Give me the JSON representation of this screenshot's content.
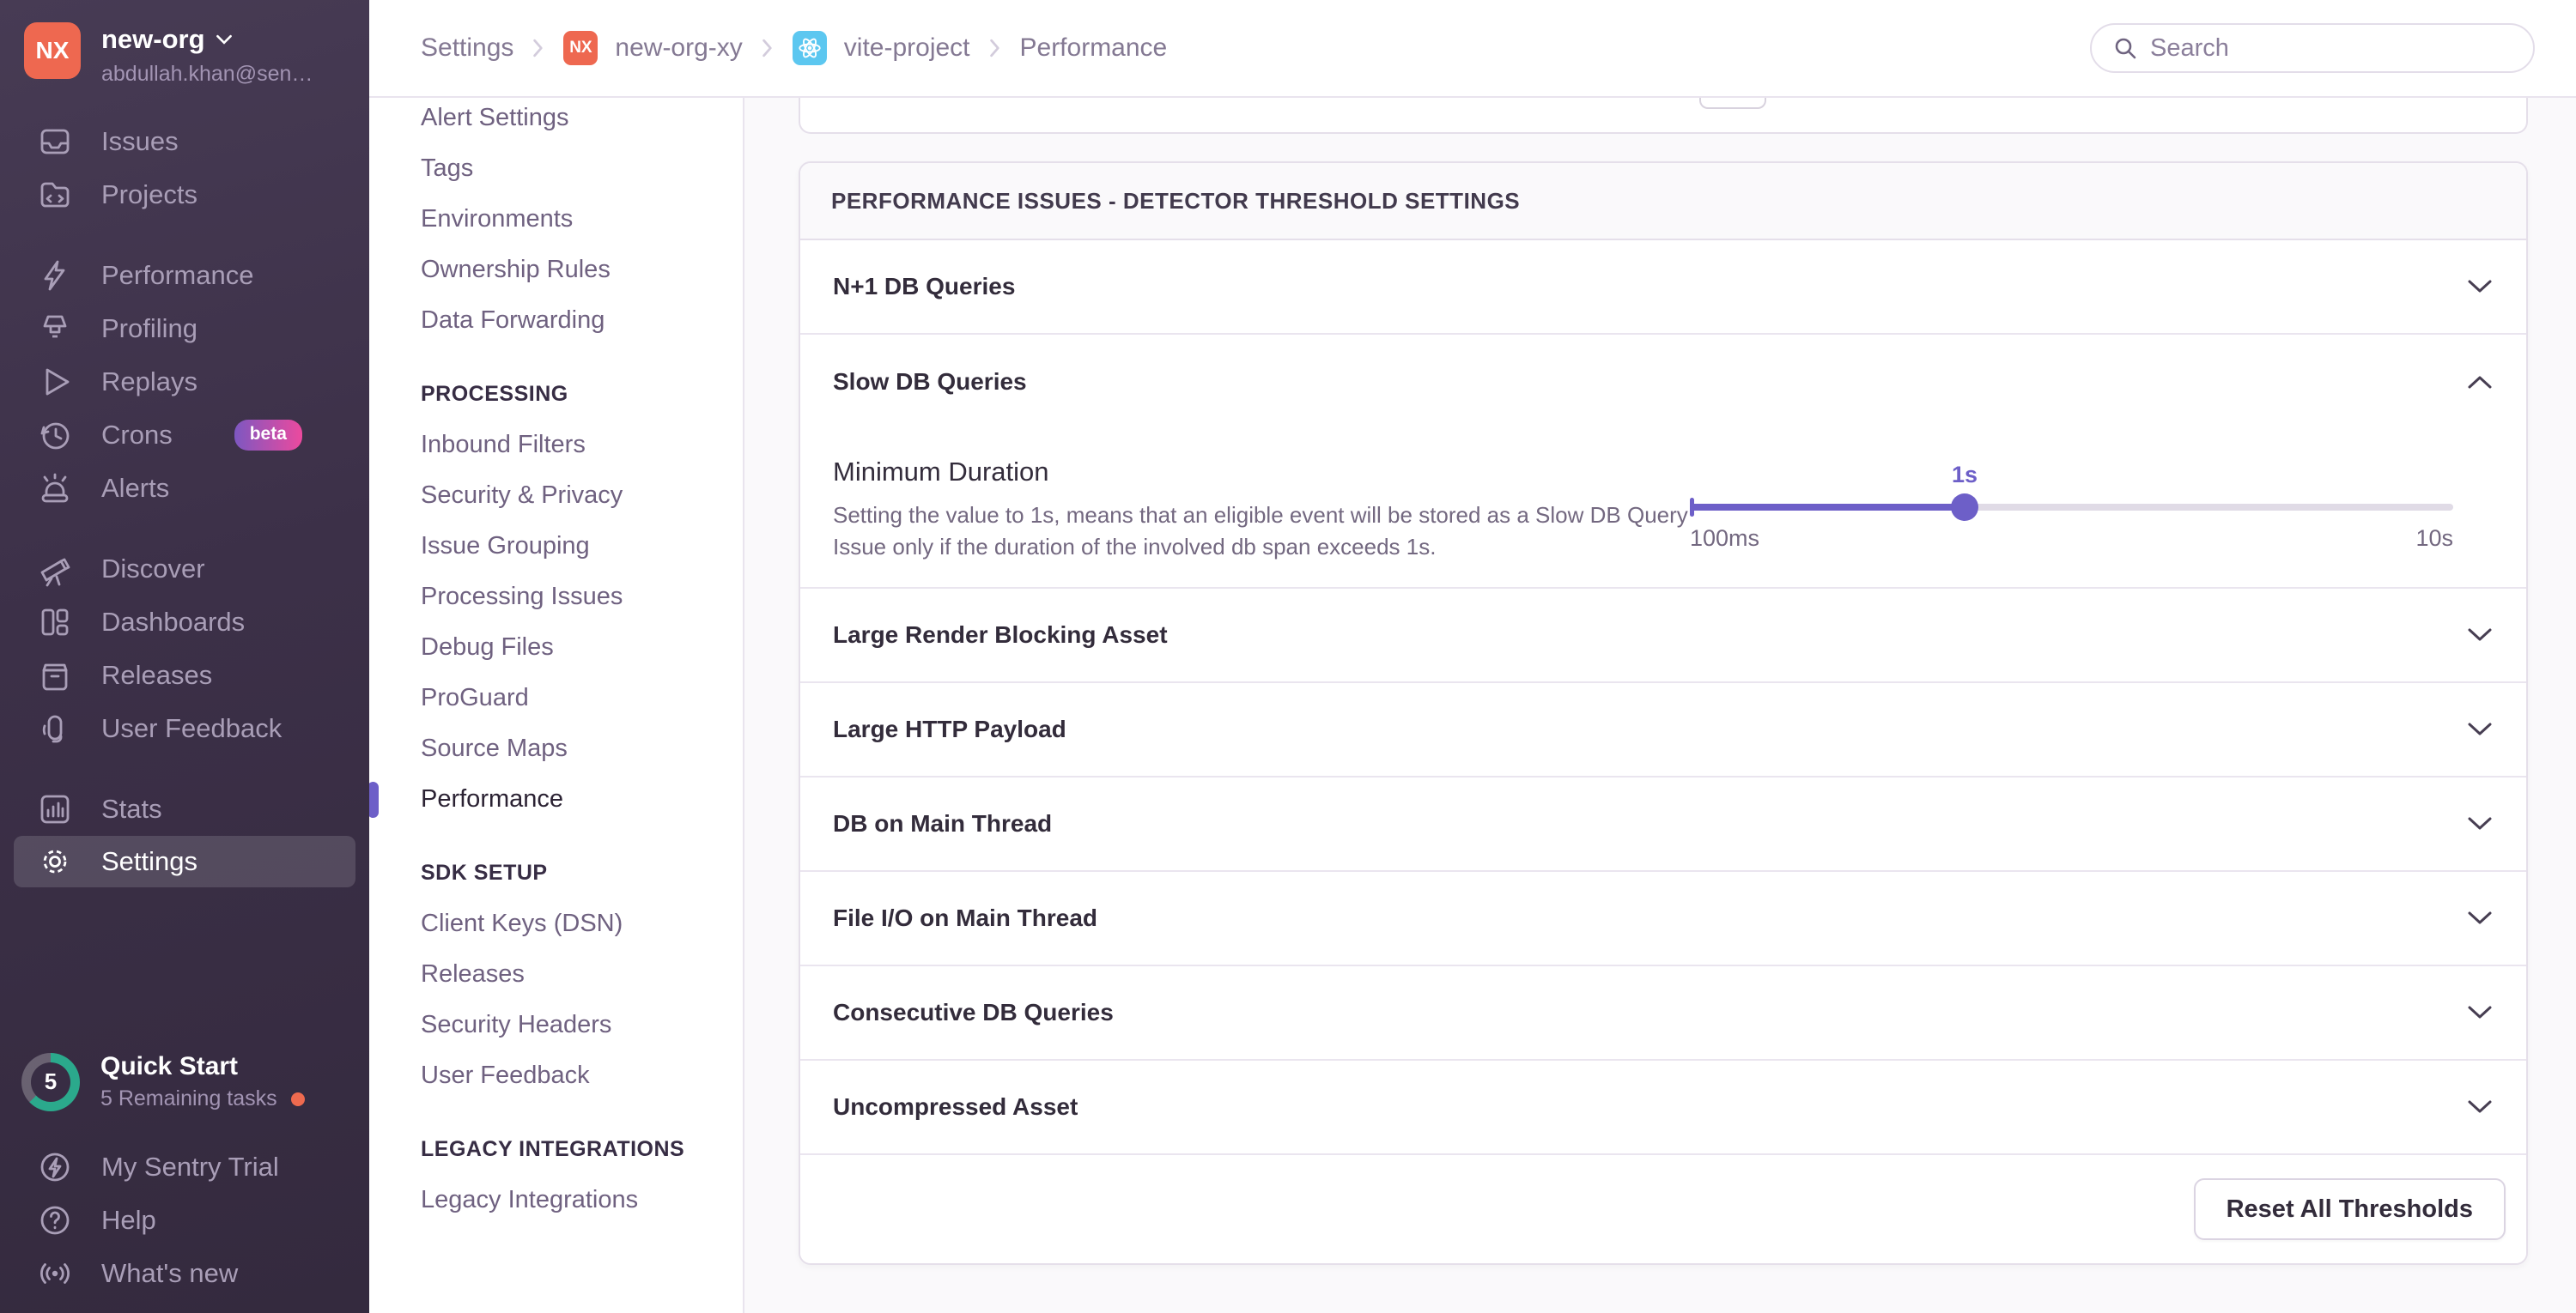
{
  "org": {
    "name": "new-org",
    "initials": "NX",
    "email": "abdullah.khan@sen…"
  },
  "topbar": {
    "breadcrumb": {
      "level1": "Settings",
      "org": "new-org-xy",
      "project": "vite-project",
      "page": "Performance"
    },
    "search_placeholder": "Search"
  },
  "sidebar": {
    "groups": [
      {
        "items": [
          {
            "label": "Issues"
          },
          {
            "label": "Projects"
          }
        ]
      },
      {
        "items": [
          {
            "label": "Performance"
          },
          {
            "label": "Profiling"
          },
          {
            "label": "Replays"
          },
          {
            "label": "Crons",
            "badge": "beta"
          },
          {
            "label": "Alerts"
          }
        ]
      },
      {
        "items": [
          {
            "label": "Discover"
          },
          {
            "label": "Dashboards"
          },
          {
            "label": "Releases"
          },
          {
            "label": "User Feedback"
          }
        ]
      },
      {
        "items": [
          {
            "label": "Stats"
          },
          {
            "label": "Settings"
          }
        ]
      }
    ],
    "quickstart": {
      "count": "5",
      "title": "Quick Start",
      "subtitle": "5 Remaining tasks"
    },
    "footer_items": [
      {
        "label": "My Sentry Trial"
      },
      {
        "label": "Help"
      },
      {
        "label": "What's new"
      }
    ]
  },
  "settings_menu": {
    "top_items": [
      "Alert Settings",
      "Tags",
      "Environments",
      "Ownership Rules",
      "Data Forwarding"
    ],
    "sections": [
      {
        "header": "PROCESSING",
        "items": [
          "Inbound Filters",
          "Security & Privacy",
          "Issue Grouping",
          "Processing Issues",
          "Debug Files",
          "ProGuard",
          "Source Maps",
          "Performance"
        ],
        "active_item": "Performance"
      },
      {
        "header": "SDK SETUP",
        "items": [
          "Client Keys (DSN)",
          "Releases",
          "Security Headers",
          "User Feedback"
        ]
      },
      {
        "header": "LEGACY INTEGRATIONS",
        "items": [
          "Legacy Integrations"
        ]
      }
    ]
  },
  "panel": {
    "header": "PERFORMANCE ISSUES - DETECTOR THRESHOLD SETTINGS",
    "rows": [
      {
        "label": "N+1 DB Queries",
        "state": "collapsed"
      },
      {
        "label": "Slow DB Queries",
        "state": "expanded"
      },
      {
        "label": "Large Render Blocking Asset",
        "state": "collapsed"
      },
      {
        "label": "Large HTTP Payload",
        "state": "collapsed"
      },
      {
        "label": "DB on Main Thread",
        "state": "collapsed"
      },
      {
        "label": "File I/O on Main Thread",
        "state": "collapsed"
      },
      {
        "label": "Consecutive DB Queries",
        "state": "collapsed"
      },
      {
        "label": "Uncompressed Asset",
        "state": "collapsed"
      }
    ],
    "expanded": {
      "title": "Minimum Duration",
      "description": "Setting the value to 1s, means that an eligible event will be stored as a Slow DB Query Issue only if the duration of the involved db span exceeds 1s.",
      "slider": {
        "value_label": "1s",
        "min_label": "100ms",
        "max_label": "10s",
        "percent": 36
      }
    },
    "footer_button": "Reset All Thresholds"
  },
  "colors": {
    "accent_purple": "#6d5fc8",
    "org_avatar_orange": "#ee6850",
    "beta_gradient_from": "#7d57c1",
    "beta_gradient_to": "#ec4a9e",
    "react_blue": "#5cc7f0",
    "progress_teal": "#2ba98c",
    "notification_orange": "#ee6a4f",
    "sidebar_dark": "#3c3048"
  }
}
